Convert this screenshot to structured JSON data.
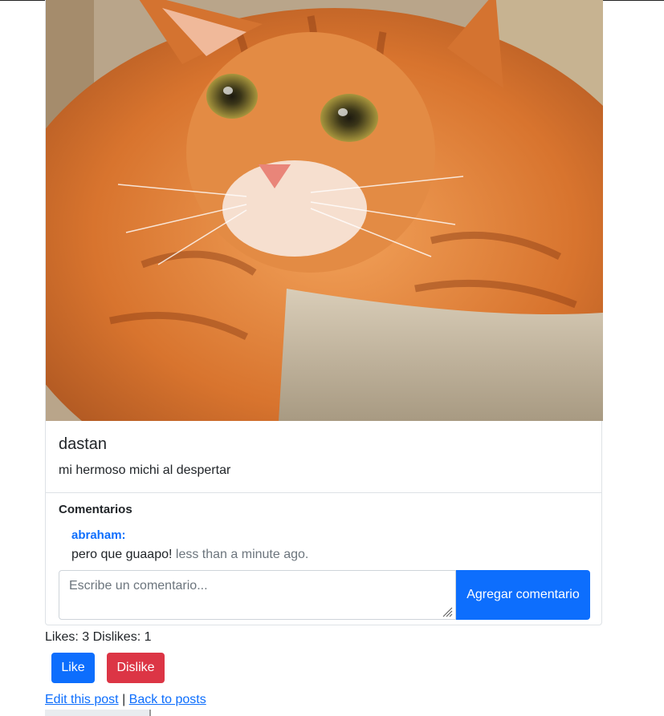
{
  "post": {
    "image_alt": "orange tabby cat",
    "author": "dastan",
    "caption": "mi hermoso michi al despertar"
  },
  "comments": {
    "title": "Comentarios",
    "items": [
      {
        "user": "abraham:",
        "text": "pero que guaapo!",
        "time": "less than a minute ago."
      }
    ],
    "input_placeholder": "Escribe un comentario...",
    "submit_label": "Agregar comentario"
  },
  "stats": {
    "text": "Likes: 3 Dislikes: 1",
    "likes": 3,
    "dislikes": 1
  },
  "actions": {
    "like_label": "Like",
    "dislike_label": "Dislike"
  },
  "links": {
    "edit_label": "Edit this post",
    "separator": "|",
    "back_label": "Back to posts"
  },
  "colors": {
    "primary": "#0d6efd",
    "danger": "#dc3545",
    "muted": "#6c757d",
    "border": "#dee2e6"
  }
}
